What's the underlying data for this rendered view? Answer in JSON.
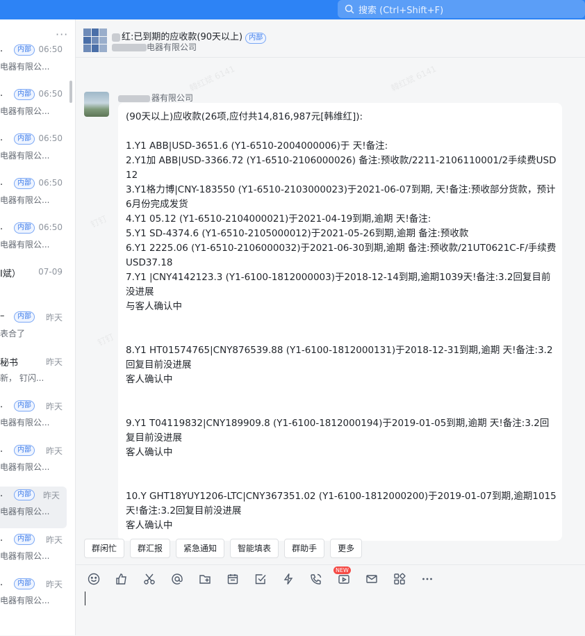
{
  "search": {
    "placeholder": "搜索 (Ctrl+Shift+F)"
  },
  "sidebar": {
    "more": "···",
    "items": [
      {
        "name": ".",
        "tag": "内部",
        "time": "06:50",
        "sub": "电器有限公..."
      },
      {
        "name": ".",
        "tag": "内部",
        "time": "06:50",
        "sub": "电器有限公..."
      },
      {
        "name": ".",
        "tag": "内部",
        "time": "06:50",
        "sub": "电器有限公..."
      },
      {
        "name": ".",
        "tag": "内部",
        "time": "06:50",
        "sub": "电器有限公..."
      },
      {
        "name": ".",
        "tag": "内部",
        "time": "06:50",
        "sub": "电器有限公..."
      },
      {
        "name": "I斌）",
        "tag": "",
        "time": "07-09",
        "sub": ""
      },
      {
        "name": "–",
        "tag": "内部",
        "time": "昨天",
        "sub": "表合了"
      },
      {
        "name": "秘书",
        "tag": "",
        "time": "昨天",
        "sub": "新， 钉闪..."
      },
      {
        "name": ".",
        "tag": "内部",
        "time": "昨天",
        "sub": "电器有限公..."
      },
      {
        "name": ".",
        "tag": "内部",
        "time": "昨天",
        "sub": "电器有限公..."
      },
      {
        "name": ".",
        "tag": "内部",
        "time": "昨天",
        "sub": "电器有限公..."
      },
      {
        "name": ".",
        "tag": "内部",
        "time": "昨天",
        "sub": "电器有限公..."
      },
      {
        "name": ".",
        "tag": "内部",
        "time": "昨天",
        "sub": "电器有限公..."
      }
    ]
  },
  "header": {
    "title": "红:已到期的应收款(90天以上)",
    "tag": "内部",
    "subtitle": "电器有限公司"
  },
  "message": {
    "sender": "器有限公司",
    "lines": [
      "(90天以上)应收款(26项,应付共14,816,987元[韩维红]):",
      "",
      "1.Y1 ABB|USD-3651.6 (Y1-6510-2004000006)于 天!备注:",
      "2.Y1加 ABB|USD-3366.72 (Y1-6510-2106000026) 备注:预收款/2211-2106110001/2手续费USD12",
      "3.Y1格力博|CNY-183550 (Y1-6510-2103000023)于2021-06-07到期, 天!备注:预收部分货款，预计6月份完成发货",
      "4.Y1 05.12 (Y1-6510-2104000021)于2021-04-19到期,逾期 天!备注:",
      "5.Y1 SD-4374.6 (Y1-6510-2105000012)于2021-05-26到期,逾期 备注:预收款",
      "6.Y1 2225.06 (Y1-6510-2106000032)于2021-06-30到期,逾期 备注:预收款/21UT0621C-F/手续费USD37.18",
      "7.Y1 |CNY4142123.3 (Y1-6100-1812000003)于2018-12-14到期,逾期1039天!备注:3.2回复目前没进展",
      "与客人确认中",
      "",
      "",
      "8.Y1 HT01574765|CNY876539.88 (Y1-6100-1812000131)于2018-12-31到期,逾期 天!备注:3.2回复目前没进展",
      "客人确认中",
      "",
      "",
      "9.Y1 T04119832|CNY189909.8 (Y1-6100-1812000194)于2019-01-05到期,逾期 天!备注:3.2回复目前没进展",
      "客人确认中",
      "",
      "",
      "10.Y GHT18YUY1206-LTC|CNY367351.02 (Y1-6100-1812000200)于2019-01-07到期,逾期1015天!备注:3.2回复目前没进展",
      "客人确认中"
    ]
  },
  "quickbar": [
    "群闲忙",
    "群汇报",
    "紧急通知",
    "智能填表",
    "群助手",
    "更多"
  ],
  "toolbar": {
    "new_badge": "NEW"
  },
  "colors": {
    "accent": "#2d83f5",
    "tag": "#3c7bea"
  }
}
